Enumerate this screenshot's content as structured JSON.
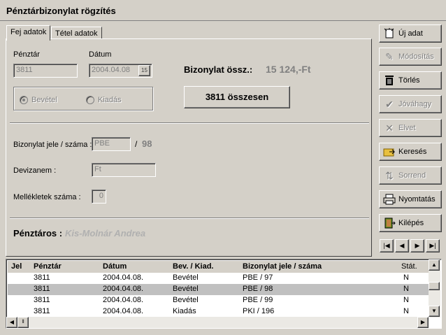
{
  "window": {
    "title": "Pénztárbizonylat rögzítés"
  },
  "tabs": [
    {
      "label": "Fej adatok",
      "active": true
    },
    {
      "label": "Tétel adatok",
      "active": false
    }
  ],
  "form": {
    "penztar_label": "Pénztár",
    "penztar_value": "3811",
    "datum_label": "Dátum",
    "datum_value": "2004.04.08",
    "bevetel_label": "Bevétel",
    "kiadas_label": "Kiadás",
    "selected_type": "Bevétel",
    "osszeg_label": "Bizonylat össz.:",
    "osszeg_value": "15 124,-Ft",
    "total_button": "3811 összesen",
    "jel_label": "Bizonylat jele / száma :",
    "jel_value": "PBE",
    "szam_sep": "/",
    "szam_value": "98",
    "deviza_label": "Devizanem :",
    "deviza_value": "Ft",
    "mellekletek_label": "Mellékletek száma :",
    "mellekletek_value": "0",
    "penztaros_label": "Pénztáros :",
    "penztaros_value": "Kis-Molnár Andrea"
  },
  "side_buttons": [
    {
      "label": "Új adat",
      "icon": "new-doc-icon",
      "enabled": true
    },
    {
      "label": "Módosítás",
      "icon": "edit-icon",
      "enabled": false
    },
    {
      "label": "Törlés",
      "icon": "trash-icon",
      "enabled": true
    },
    {
      "label": "Jóváhagy",
      "icon": "check-icon",
      "enabled": false
    },
    {
      "label": "Elvet",
      "icon": "x-icon",
      "enabled": false
    },
    {
      "label": "Keresés",
      "icon": "search-folder-icon",
      "enabled": true
    },
    {
      "label": "Sorrend",
      "icon": "sort-icon",
      "enabled": false
    },
    {
      "label": "Nyomtatás",
      "icon": "printer-icon",
      "enabled": true
    },
    {
      "label": "Kilépés",
      "icon": "exit-door-icon",
      "enabled": true
    }
  ],
  "nav": {
    "first": "|◀",
    "prev": "◀",
    "next": "▶",
    "last": "▶|"
  },
  "grid": {
    "columns": [
      "Jel",
      "Pénztár",
      "Dátum",
      "Bev. / Kiad.",
      "Bizonylat jele / száma",
      "Stát."
    ],
    "rows": [
      [
        "",
        "3811",
        "2004.04.08.",
        "Bevétel",
        "PBE / 97",
        "N"
      ],
      [
        "",
        "3811",
        "2004.04.08.",
        "Bevétel",
        "PBE / 98",
        "N"
      ],
      [
        "",
        "3811",
        "2004.04.08.",
        "Bevétel",
        "PBE / 99",
        "N"
      ],
      [
        "",
        "3811",
        "2004.04.08.",
        "Kiadás",
        "PKI / 196",
        "N"
      ]
    ],
    "selected_row": 1
  }
}
